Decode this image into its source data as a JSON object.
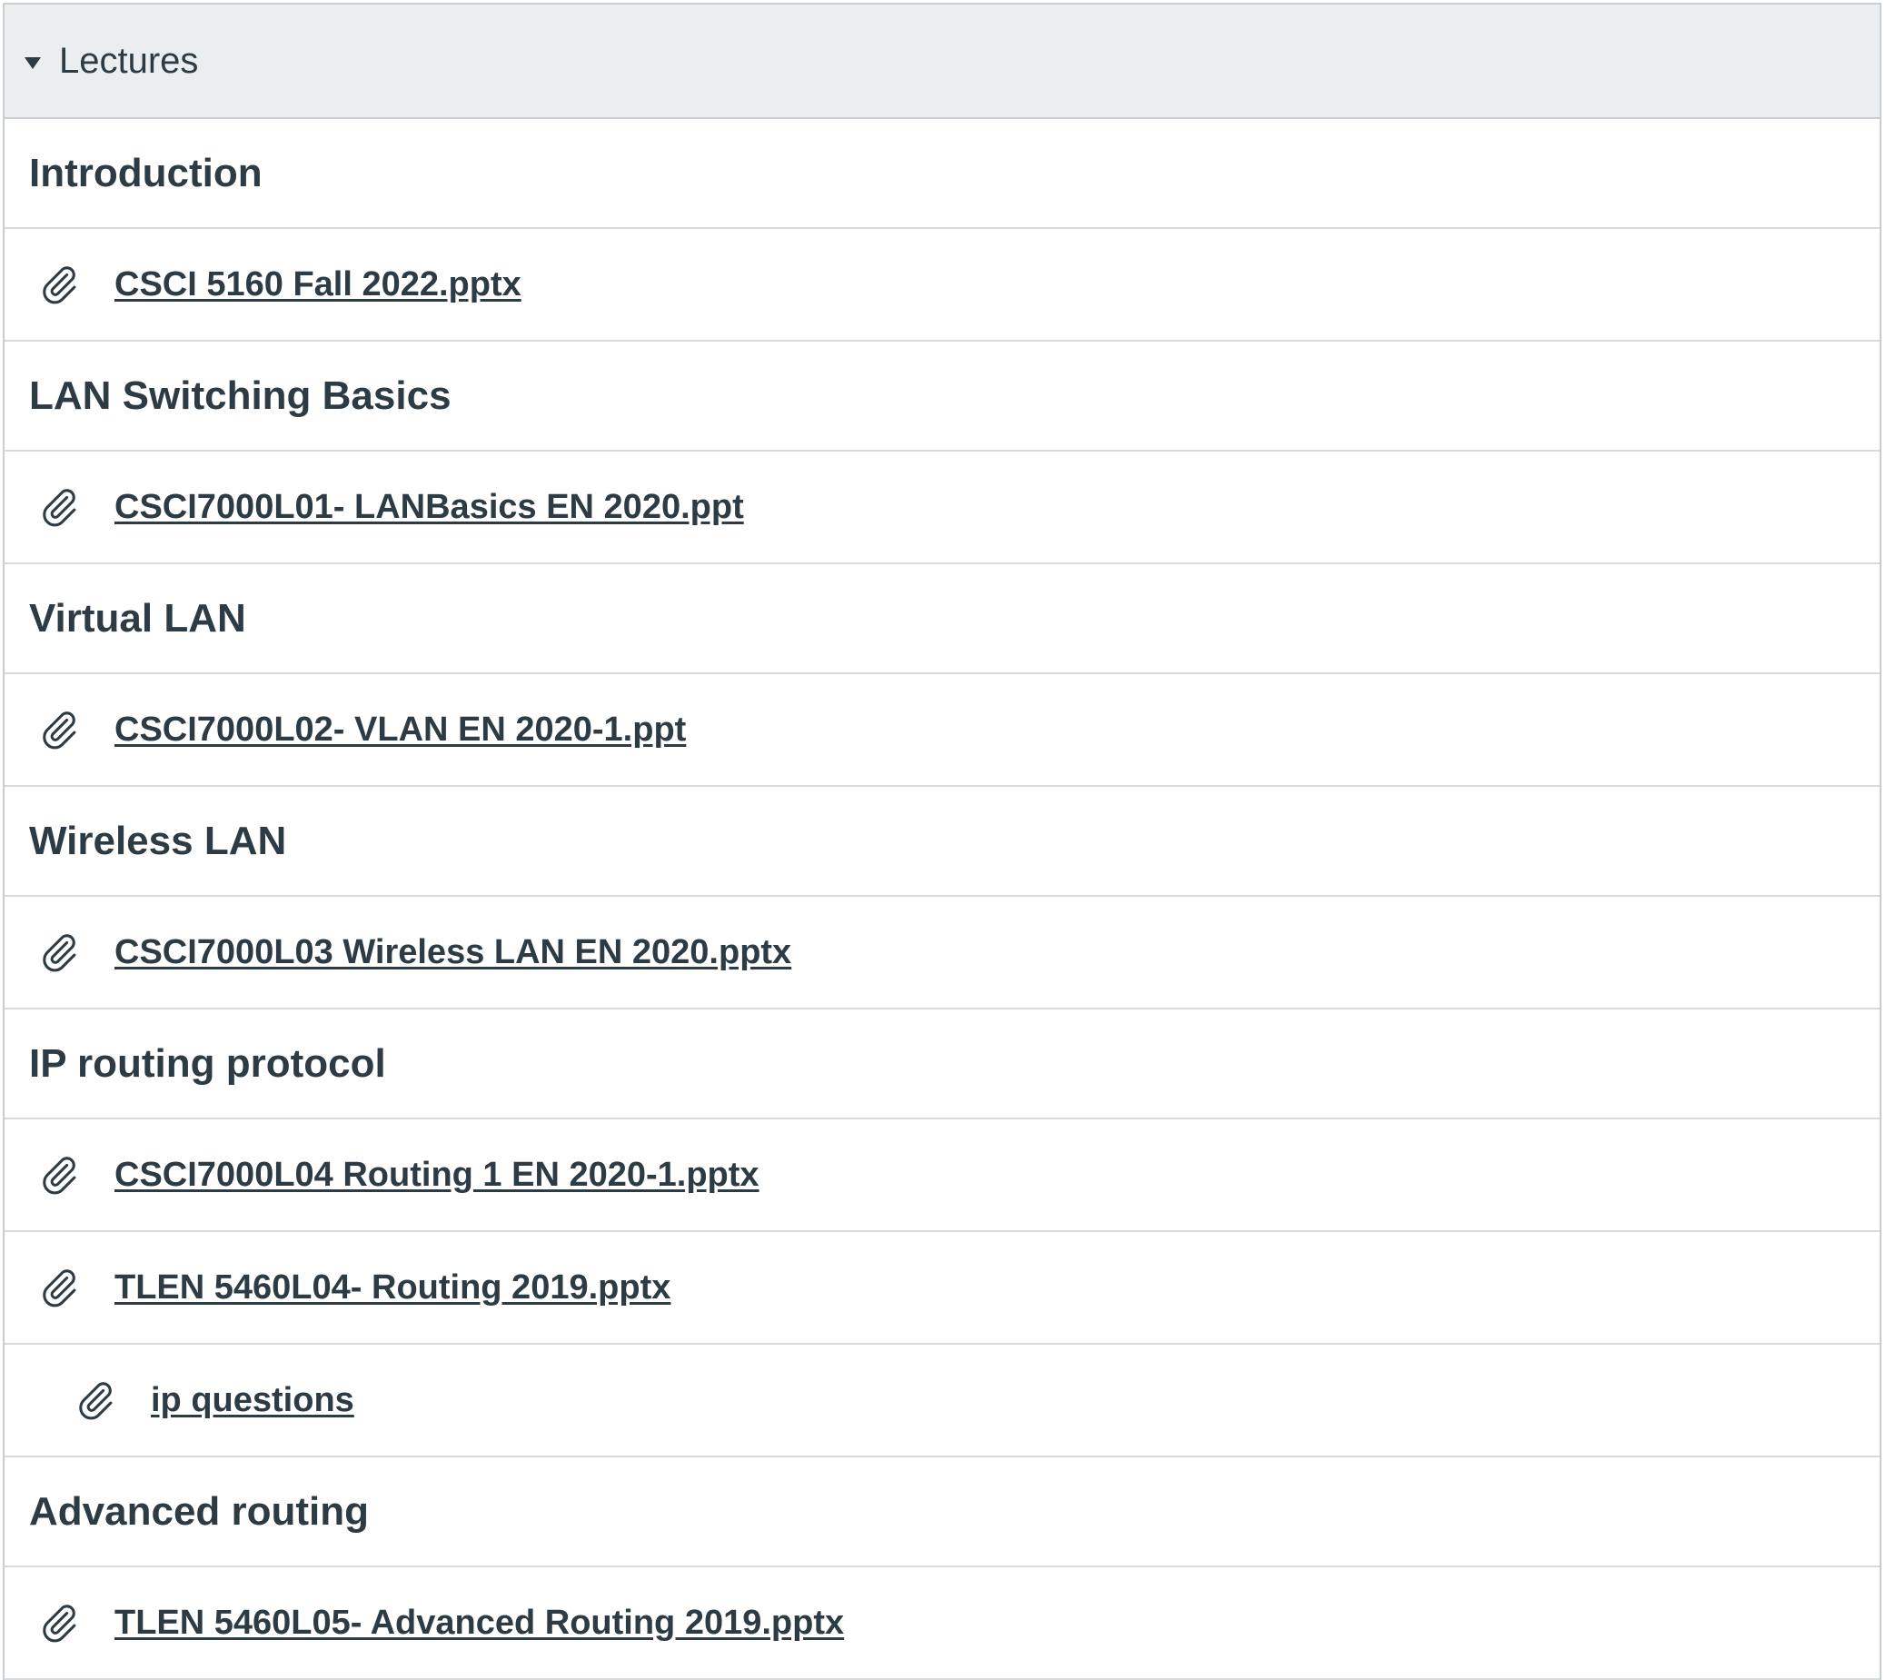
{
  "module": {
    "title": "Lectures",
    "items": [
      {
        "type": "header",
        "text": "Introduction"
      },
      {
        "type": "file",
        "text": "CSCI 5160 Fall 2022.pptx",
        "indent": 0
      },
      {
        "type": "header",
        "text": "LAN Switching Basics"
      },
      {
        "type": "file",
        "text": "CSCI7000L01- LANBasics EN 2020.ppt",
        "indent": 0
      },
      {
        "type": "header",
        "text": "Virtual LAN"
      },
      {
        "type": "file",
        "text": "CSCI7000L02- VLAN EN 2020-1.ppt",
        "indent": 0
      },
      {
        "type": "header",
        "text": "Wireless LAN"
      },
      {
        "type": "file",
        "text": "CSCI7000L03 Wireless LAN EN 2020.pptx",
        "indent": 0
      },
      {
        "type": "header",
        "text": "IP routing protocol"
      },
      {
        "type": "file",
        "text": "CSCI7000L04 Routing 1 EN 2020-1.pptx",
        "indent": 0
      },
      {
        "type": "file",
        "text": "TLEN 5460L04- Routing 2019.pptx",
        "indent": 0
      },
      {
        "type": "file",
        "text": "ip questions",
        "indent": 1
      },
      {
        "type": "header",
        "text": "Advanced routing"
      },
      {
        "type": "file",
        "text": "TLEN 5460L05- Advanced Routing 2019.pptx",
        "indent": 0
      }
    ]
  },
  "icons": {
    "collapse": "caret-down-icon",
    "attachment": "paperclip-icon"
  },
  "colors": {
    "text": "#2d3b45",
    "header_bg": "#ebeef0",
    "border": "#c7cdd1"
  }
}
